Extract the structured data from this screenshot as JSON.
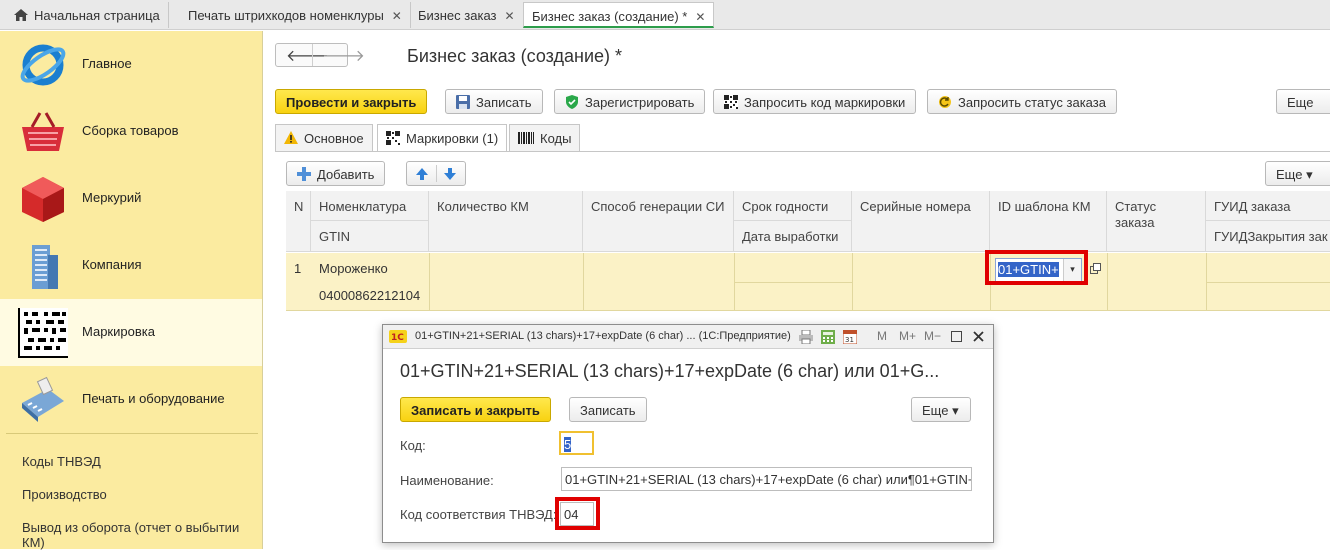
{
  "tabs": {
    "home": "Начальная страница",
    "t1": "Печать штрихкодов номенклуры",
    "t2": "Бизнес заказ",
    "t3": "Бизнес заказ (создание) *",
    "close": "✕"
  },
  "sidebar": {
    "items": [
      {
        "label": "Главное"
      },
      {
        "label": "Сборка товаров"
      },
      {
        "label": "Меркурий"
      },
      {
        "label": "Компания"
      },
      {
        "label": "Маркировка"
      },
      {
        "label": "Печать и оборудование"
      }
    ],
    "links": [
      "Коды ТНВЭД",
      "Производство",
      "Вывод из оборота (отчет о выбытии КМ)"
    ]
  },
  "form": {
    "title": "Бизнес заказ (создание) *",
    "back": "🡐",
    "forward": "🡒",
    "toolbar": {
      "post_close": "Провести и закрыть",
      "save": "Записать",
      "register": "Зарегистрировать",
      "request_code": "Запросить код маркировки",
      "request_status": "Запросить статус заказа",
      "more": "Еще"
    },
    "subtabs": [
      "Основное",
      "Маркировки (1)",
      "Коды"
    ],
    "table_toolbar": {
      "add": "Добавить",
      "more": "Еще"
    }
  },
  "table": {
    "headers": {
      "n": "N",
      "nomenclature": "Номенклатура",
      "gtin": "GTIN",
      "qty": "Количество КМ",
      "gen": "Способ генерации СИ",
      "expiry": "Срок годности",
      "prod_date": "Дата выработки",
      "serials": "Серийные номера",
      "template": "ID шаблона КМ",
      "status": "Статус заказа",
      "guid": "ГУИД заказа",
      "guid_close": "ГУИДЗакрытия зак"
    },
    "rows": [
      {
        "n": "1",
        "name": "Мороженко",
        "gtin": "04000862212104",
        "template": "01+GTIN+"
      }
    ]
  },
  "dialog": {
    "window_title": "01+GTIN+21+SERIAL (13 chars)+17+expDate (6 char) ... (1С:Предприятие)",
    "heading": "01+GTIN+21+SERIAL (13 chars)+17+expDate (6 char) или 01+G...",
    "save_close": "Записать и закрыть",
    "save": "Записать",
    "more": "Еще",
    "code_label": "Код:",
    "code_value": "5",
    "name_label": "Наименование:",
    "name_value": "01+GTIN+21+SERIAL (13 chars)+17+expDate (6 char) или¶01+GTIN+",
    "tnved_label": "Код соответствия ТНВЭД:",
    "tnved_value": "04",
    "icons_m": "M",
    "icons_mplus": "M+",
    "icons_mminus": "M−"
  },
  "colors": {
    "accent_yellow": "#f8d211",
    "sidebar": "#fbeba0",
    "highlight_red": "#e00000",
    "active_tab_line": "#2d9d4b"
  }
}
